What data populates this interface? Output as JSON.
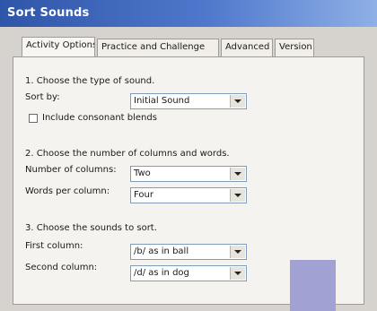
{
  "window": {
    "title": "Sort Sounds"
  },
  "tabs": [
    {
      "label": "Activity Options"
    },
    {
      "label": "Practice and Challenge"
    },
    {
      "label": "Advanced"
    },
    {
      "label": "Version"
    }
  ],
  "section1": {
    "heading": "1.  Choose the type of sound.",
    "sort_by_label": "Sort by:",
    "sort_by_value": "Initial Sound",
    "blends_label": "Include consonant blends"
  },
  "section2": {
    "heading": "2.  Choose the number of columns and words.",
    "columns_label": "Number of columns:",
    "columns_value": "Two",
    "words_label": "Words per column:",
    "words_value": "Four"
  },
  "section3": {
    "heading": "3.  Choose the sounds to sort.",
    "first_label": "First column:",
    "first_value": "/b/ as in ball",
    "second_label": "Second column:",
    "second_value": "/d/ as in dog"
  }
}
